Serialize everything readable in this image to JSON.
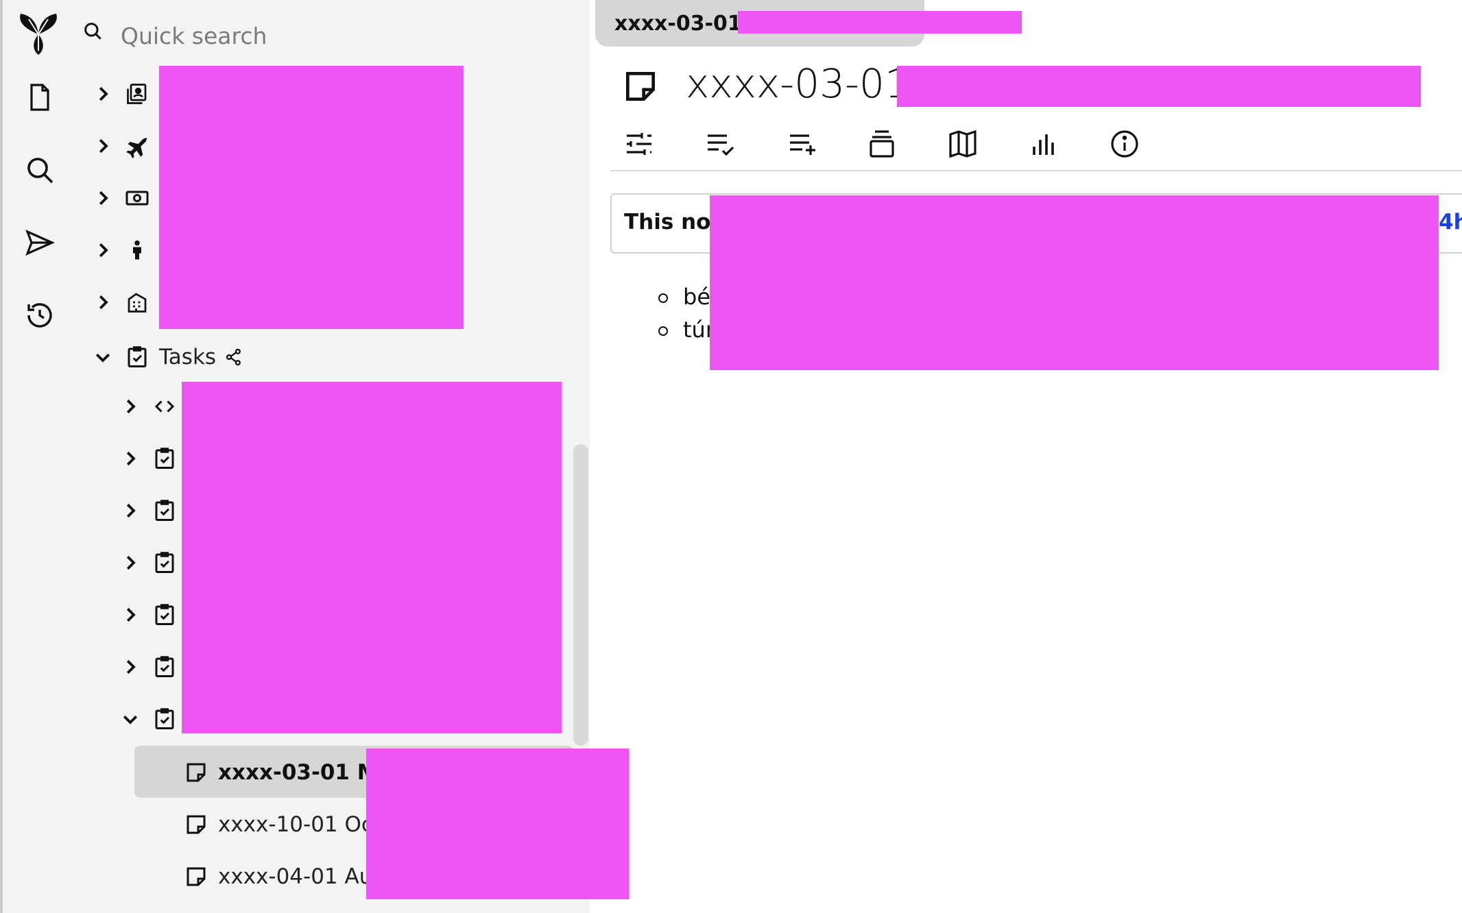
{
  "search": {
    "placeholder": "Quick search"
  },
  "launcher": {
    "items": [
      {
        "name": "new-note",
        "icon": "file-icon"
      },
      {
        "name": "search",
        "icon": "search-icon"
      },
      {
        "name": "jump-to",
        "icon": "send-icon"
      },
      {
        "name": "recent-changes",
        "icon": "history-icon"
      }
    ]
  },
  "tree": {
    "tasks_label": "Tasks",
    "selected_note": "xxxx-03-01 Ma",
    "notes": [
      {
        "label": "xxxx-10-01 Oct"
      },
      {
        "label": "xxxx-04-01 Au"
      }
    ]
  },
  "tab": {
    "title": "xxxx-03-01"
  },
  "note": {
    "title": "xxxx-03-01",
    "info_text": "This not",
    "info_link": "4h",
    "list": [
      "bé",
      "túr"
    ]
  },
  "ribbon": [
    {
      "name": "basic-properties",
      "icon": "sliders-icon"
    },
    {
      "name": "promoted-attributes",
      "icon": "list-check-icon"
    },
    {
      "name": "owned-attributes",
      "icon": "list-plus-icon"
    },
    {
      "name": "inherited-attributes",
      "icon": "layers-icon"
    },
    {
      "name": "note-map",
      "icon": "map-icon"
    },
    {
      "name": "similar-notes",
      "icon": "bar-chart-icon"
    },
    {
      "name": "note-info",
      "icon": "info-icon"
    }
  ],
  "colors": {
    "redaction": "#ee55f5",
    "link": "#1a3ee8",
    "panel": "#f3f3f3"
  }
}
